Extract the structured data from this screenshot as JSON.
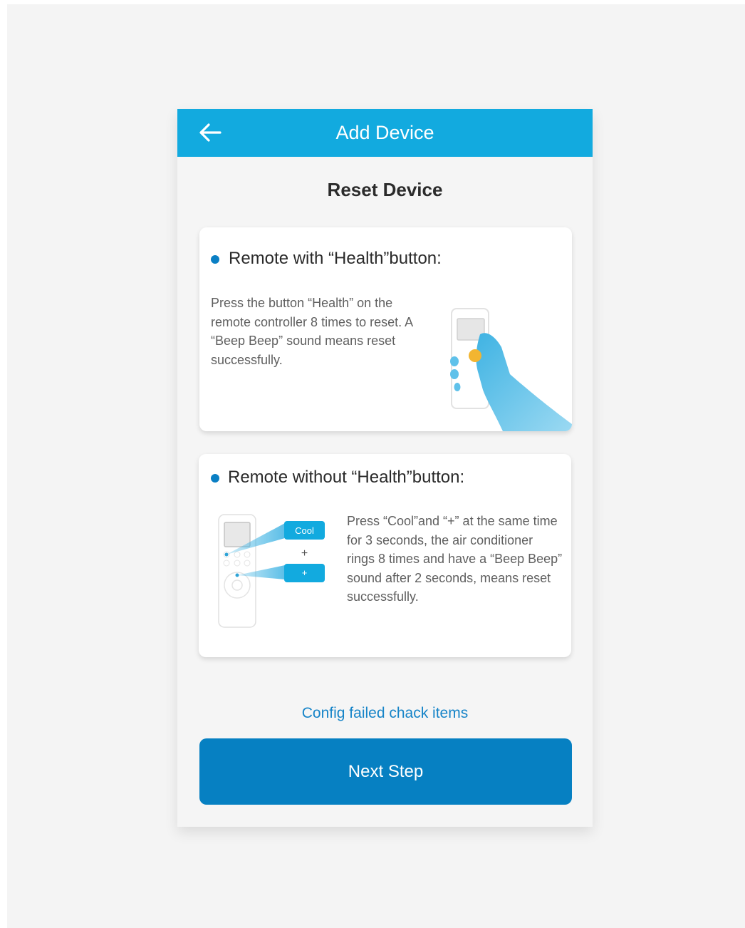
{
  "header": {
    "title": "Add Device",
    "back_icon": "arrow-left-icon"
  },
  "page": {
    "title": "Reset Device"
  },
  "cards": [
    {
      "title": "Remote with “Health”button:",
      "description": "Press the button “Health” on the remote controller 8 times to reset. A “Beep Beep” sound means reset successfully.",
      "illustration": "hand-pressing-remote-illustration"
    },
    {
      "title": "Remote without “Health”button:",
      "description": "Press “Cool”and “+” at the same time for 3 seconds, the air conditioner rings 8 times and have a  “Beep Beep” sound after 2 seconds, means reset successfully.",
      "illustration": "remote-cool-plus-illustration",
      "cool_label": "Cool",
      "plus_label": "+",
      "plus_small_label": "+"
    }
  ],
  "footer": {
    "link_label": "Config failed chack items",
    "next_label": "Next Step"
  },
  "colors": {
    "header": "#12aadf",
    "accent": "#0680c2",
    "link": "#1684c8",
    "highlight": "#f2b531"
  }
}
